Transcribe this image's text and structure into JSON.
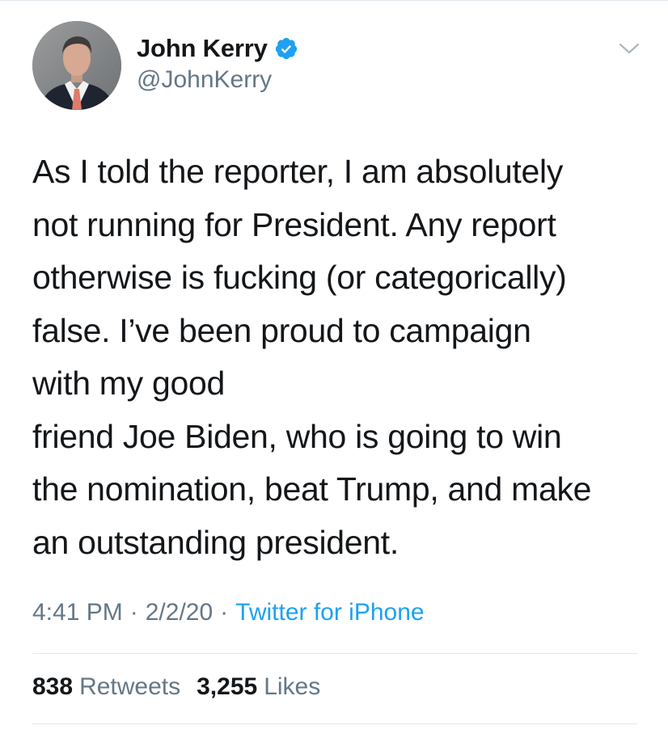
{
  "author": {
    "display_name": "John Kerry",
    "handle": "@JohnKerry",
    "verified": true,
    "avatar": "profile-photo"
  },
  "tweet": {
    "text": "As I told the reporter, I am absolutely\nnot running for President. Any report\notherwise is fucking (or categorically)\nfalse. I’ve been proud to campaign\nwith my good\nfriend Joe Biden, who is going to win\nthe nomination, beat Trump, and make\nan outstanding president.",
    "time": "4:41 PM",
    "separator": "·",
    "date": "2/2/20",
    "source": "Twitter for iPhone"
  },
  "stats": {
    "retweets_count": "838",
    "retweets_label": "Retweets",
    "likes_count": "3,255",
    "likes_label": "Likes"
  },
  "icons": {
    "verified": "verified-badge-icon",
    "menu": "chevron-down-icon"
  },
  "colors": {
    "text": "#14171a",
    "secondary": "#657786",
    "accent": "#1da1f2",
    "divider": "#e1e8ed"
  }
}
